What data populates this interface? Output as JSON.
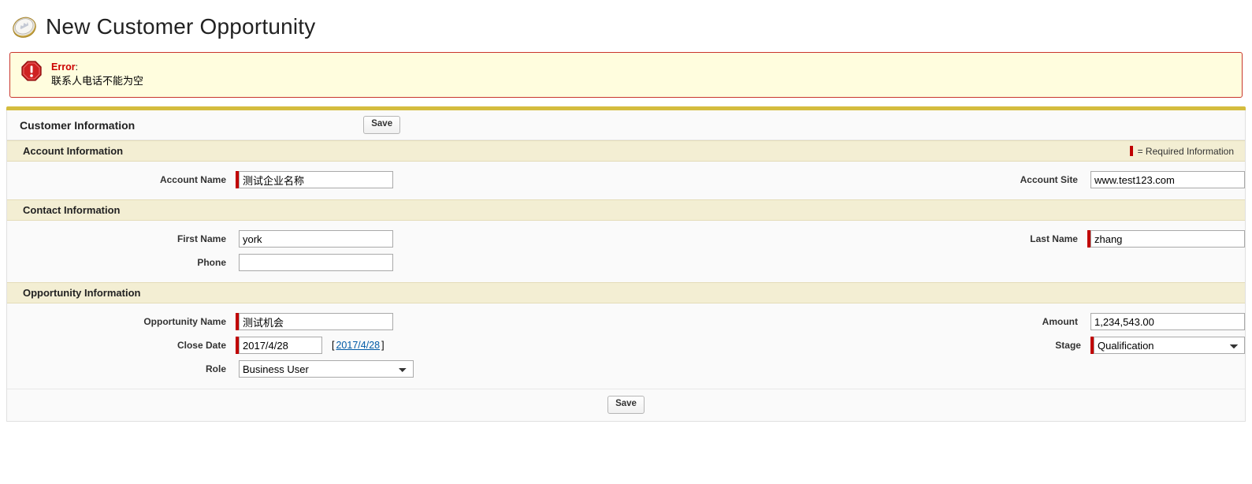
{
  "page": {
    "title": "New Customer Opportunity",
    "title_icon": "opportunity-coin-icon"
  },
  "error": {
    "icon": "error-octagon-icon",
    "label": "Error",
    "colon": ":",
    "message": "联系人电话不能为空"
  },
  "block": {
    "title": "Customer Information",
    "save_top_label": "Save",
    "save_bottom_label": "Save"
  },
  "legend": {
    "required_text": "= Required Information",
    "required_color": "#c00000"
  },
  "sections": {
    "account": {
      "title": "Account Information",
      "fields": {
        "account_name": {
          "label": "Account Name",
          "value": "测试企业名称",
          "required": true
        },
        "account_site": {
          "label": "Account Site",
          "value": "www.test123.com",
          "required": false
        }
      }
    },
    "contact": {
      "title": "Contact Information",
      "fields": {
        "first_name": {
          "label": "First Name",
          "value": "york",
          "required": false
        },
        "last_name": {
          "label": "Last Name",
          "value": "zhang",
          "required": true
        },
        "phone": {
          "label": "Phone",
          "value": "",
          "required": false
        }
      }
    },
    "opportunity": {
      "title": "Opportunity Information",
      "fields": {
        "opportunity_name": {
          "label": "Opportunity Name",
          "value": "测试机会",
          "required": true
        },
        "amount": {
          "label": "Amount",
          "value": "1,234,543.00",
          "required": false
        },
        "close_date": {
          "label": "Close Date",
          "value": "2017/4/28",
          "required": true,
          "bracket_open": "[",
          "link_text": "2017/4/28",
          "bracket_close": "]"
        },
        "stage": {
          "label": "Stage",
          "value": "Qualification",
          "required": true,
          "options": [
            "Qualification"
          ]
        },
        "role": {
          "label": "Role",
          "value": "Business User",
          "required": false,
          "options": [
            "Business User"
          ]
        }
      }
    }
  },
  "colors": {
    "block_top_bar": "#d4bc3e",
    "section_header_bg": "#f3eed3",
    "error_border": "#c9362c",
    "error_bg": "#fffdde",
    "error_label": "#cc0000"
  }
}
